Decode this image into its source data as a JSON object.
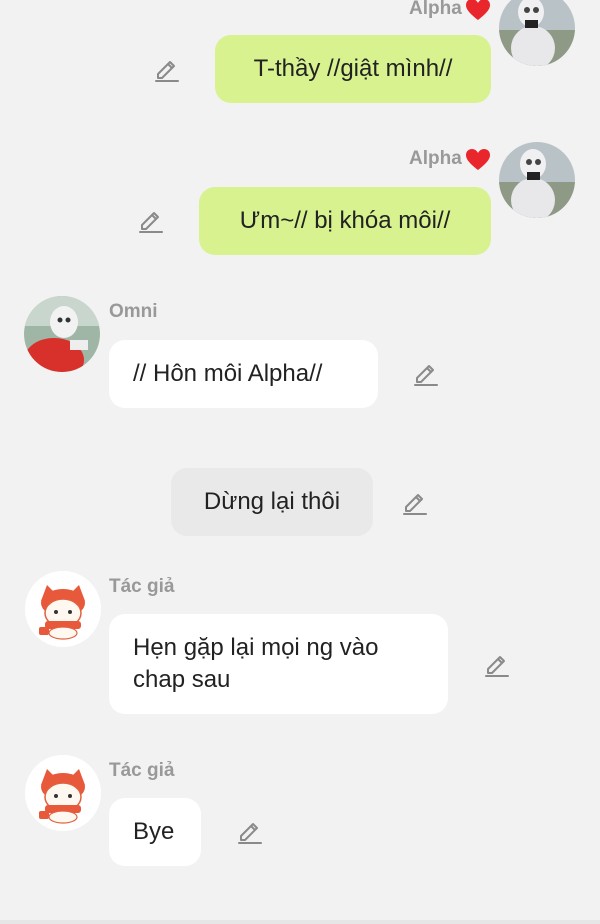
{
  "messages": [
    {
      "sender": "Alpha",
      "text": "T-thầy //giật mình//"
    },
    {
      "sender": "Alpha",
      "text": "Ưm~// bị khóa môi//"
    },
    {
      "sender": "Omni",
      "text": "// Hôn môi Alpha//"
    },
    {
      "sender": "",
      "text": "Dừng lại thôi"
    },
    {
      "sender": "Tác giả",
      "text": "Hẹn gặp lại mọi ng vào chap sau"
    },
    {
      "sender": "Tác giả",
      "text": "Bye"
    }
  ],
  "icons": {
    "edit": "pencil-edit-icon",
    "heart": "heart-icon"
  },
  "colors": {
    "background": "#f2f2f2",
    "green_bubble": "#d7f28f",
    "white_bubble": "#ffffff",
    "narration_bubble": "#e9e9e9",
    "heart": "#e8262b",
    "name_text": "#999999"
  }
}
